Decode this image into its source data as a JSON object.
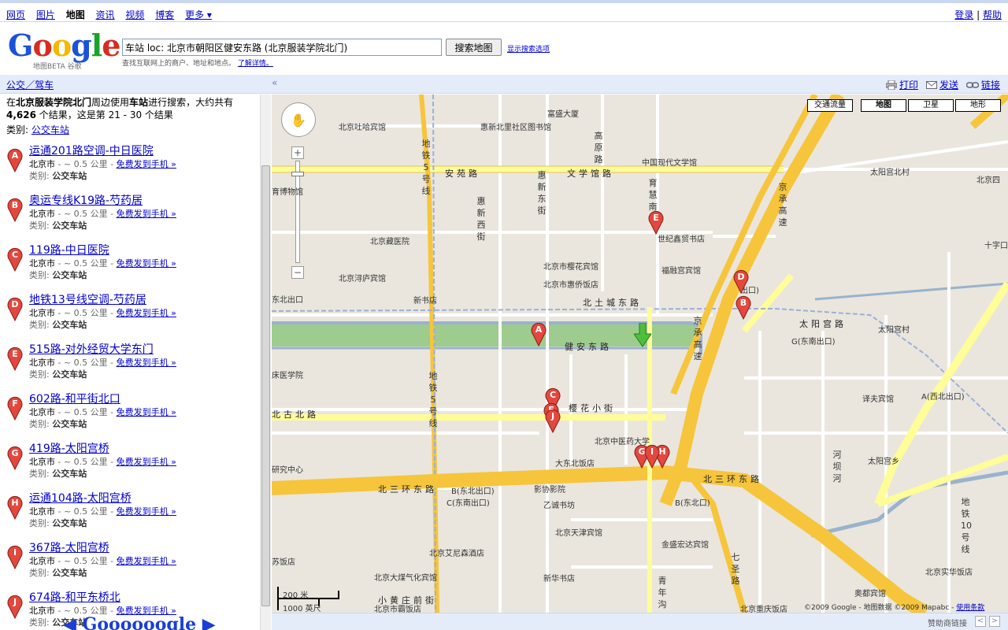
{
  "topnav": {
    "items": [
      "网页",
      "图片",
      "地图",
      "资讯",
      "视频",
      "博客"
    ],
    "selected_index": 2,
    "more": "更多 ▾",
    "login": "登录",
    "help": "帮助",
    "separator": "|"
  },
  "logo": {
    "text": "Google",
    "subtitle": "地图BETA 谷歌"
  },
  "search": {
    "value": "车站 loc: 北京市朝阳区健安东路 (北京服装学院北门)",
    "button": "搜索地图",
    "show_options": "显示搜索选项",
    "hint": "查找互联网上的商户、地址和地点。",
    "learn_more": "了解详情。"
  },
  "subbar": {
    "tab": "公交／驾车",
    "collapse": "«",
    "print": "打印",
    "send": "发送",
    "link": "链接"
  },
  "results": {
    "summary_pre": "在",
    "summary_loc": "北京服装学院北门",
    "summary_mid": "周边使用",
    "summary_kw": "车站",
    "summary_post": "进行搜索，大约共有",
    "summary_count": "4,626",
    "summary_tail": " 个结果，这是第 21 - 30 个结果",
    "category_label": "类别:",
    "category_value": "公交车站",
    "items": [
      {
        "letter": "A",
        "title": "运通201路空调-中日医院",
        "city": "北京市",
        "dist": " - ~ 0.5 公里 - ",
        "send": "免费发到手机 »",
        "cat_label": "类别:",
        "cat": "公交车站"
      },
      {
        "letter": "B",
        "title": "奥运专线K19路-芍药居",
        "city": "北京市",
        "dist": " - ~ 0.5 公里 - ",
        "send": "免费发到手机 »",
        "cat_label": "类别:",
        "cat": "公交车站"
      },
      {
        "letter": "C",
        "title": "119路-中日医院",
        "city": "北京市",
        "dist": " - ~ 0.5 公里 - ",
        "send": "免费发到手机 »",
        "cat_label": "类别:",
        "cat": "公交车站"
      },
      {
        "letter": "D",
        "title": "地铁13号线空调-芍药居",
        "city": "北京市",
        "dist": " - ~ 0.5 公里 - ",
        "send": "免费发到手机 »",
        "cat_label": "类别:",
        "cat": "公交车站"
      },
      {
        "letter": "E",
        "title": "515路-对外经贸大学东门",
        "city": "北京市",
        "dist": " - ~ 0.5 公里 - ",
        "send": "免费发到手机 »",
        "cat_label": "类别:",
        "cat": "公交车站"
      },
      {
        "letter": "F",
        "title": "602路-和平街北口",
        "city": "北京市",
        "dist": " - ~ 0.5 公里 - ",
        "send": "免费发到手机 »",
        "cat_label": "类别:",
        "cat": "公交车站"
      },
      {
        "letter": "G",
        "title": "419路-太阳宫桥",
        "city": "北京市",
        "dist": " - ~ 0.5 公里 - ",
        "send": "免费发到手机 »",
        "cat_label": "类别:",
        "cat": "公交车站"
      },
      {
        "letter": "H",
        "title": "运通104路-太阳宫桥",
        "city": "北京市",
        "dist": " - ~ 0.5 公里 - ",
        "send": "免费发到手机 »",
        "cat_label": "类别:",
        "cat": "公交车站"
      },
      {
        "letter": "I",
        "title": "367路-太阳宫桥",
        "city": "北京市",
        "dist": " - ~ 0.5 公里 - ",
        "send": "免费发到手机 »",
        "cat_label": "类别:",
        "cat": "公交车站"
      },
      {
        "letter": "J",
        "title": "674路-和平东桥北",
        "city": "北京市",
        "dist": " - ~ 0.5 公里 - ",
        "send": "免费发到手机 »",
        "cat_label": "类别:",
        "cat": "公交车站"
      }
    ],
    "pager": "◀ Goooooogle ▶"
  },
  "map": {
    "types": [
      "交通流量",
      "地图",
      "卫星",
      "地形"
    ],
    "selected_type": "地图",
    "scale_metric": "200 米",
    "scale_imperial": "1000 英尺",
    "copyright": "©2009 Google - 地图数据 ©2009 Mapabc - ",
    "terms": "使用条款",
    "footer": "赞助商链接",
    "pin_color": "#e2483e",
    "road_major": "#f6c53b",
    "road_minor": "#fefd98",
    "water": "#99b3cc",
    "park": "#9ecb8e",
    "pins": [
      "A",
      "B",
      "C",
      "D",
      "E",
      "F",
      "G",
      "H",
      "I",
      "J"
    ],
    "labels": [
      "北京吐哈宾馆",
      "惠新北里社区图书馆",
      "富盛大厦",
      "中国现代文学馆",
      "太阳宫北村",
      "育博物馆",
      "北京藏医院",
      "世纪鑫贸书店",
      "北京市樱花宾馆",
      "福融宫宾馆",
      "北京浔庐宾馆",
      "北京市惠侨饭店",
      "新书店",
      "东北出口",
      "G(东南出口)",
      "太阳宫村",
      "床医学院",
      "译夫宾馆",
      "A(西北出口)",
      "北京中医药大学",
      "大东北饭店",
      "研究中心",
      "B(东北出口)",
      "C(东南出口)",
      "影协影院",
      "乙诚书坊",
      "B(东北口)",
      "北京天津宾馆",
      "北京艾尼森酒店",
      "金盛宏达宾馆",
      "苏饭店",
      "北京大煤气化宾馆",
      "新华书店",
      "北京市霸饭店",
      "北京重庆饭店",
      "奥都宾馆",
      "北京实华饭店",
      "太阳宫乡",
      "十字口",
      "出口)",
      "北京四"
    ],
    "streets_h": [
      "安苑路",
      "文学馆路",
      "北土城东路",
      "健安东路",
      "樱花小街",
      "北三环东路",
      "北三环东路",
      "太阳宫路",
      "北古北路",
      "小黄庄前街"
    ],
    "streets_v": [
      "地铁5号线",
      "惠新西街",
      "惠新东街",
      "高原路",
      "育慧南",
      "京承高速",
      "京承高速",
      "地铁5号线",
      "地铁10号线",
      "河坝河",
      "七圣路",
      "青年沟"
    ]
  }
}
